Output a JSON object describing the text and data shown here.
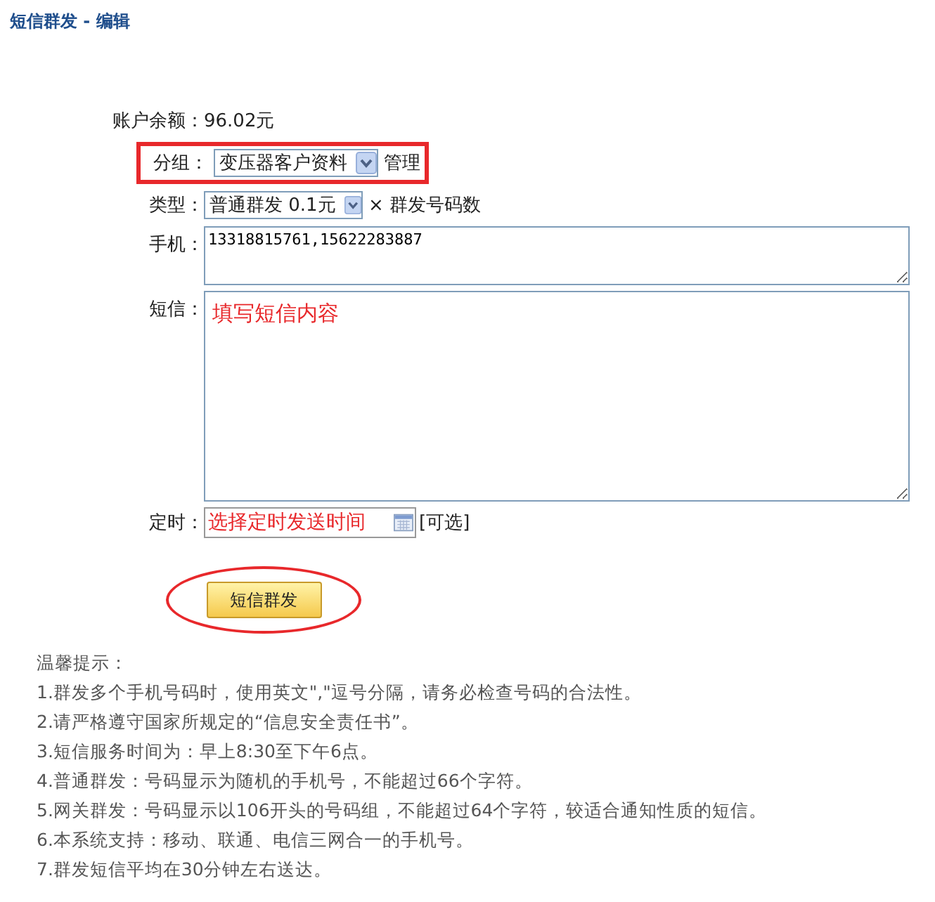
{
  "title": "短信群发 - 编辑",
  "balance": {
    "label": "账户余额：",
    "value": "96.02元"
  },
  "group": {
    "label": "分组：",
    "value": "变压器客户资料",
    "link": "管理",
    "highlighted": true
  },
  "type": {
    "label": "类型：",
    "value": "普通群发 0.1元",
    "suffix": "× 群发号码数"
  },
  "phone": {
    "label": "手机：",
    "value": "13318815761,15622283887"
  },
  "message": {
    "label": "短信：",
    "placeholder": "填写短信内容"
  },
  "schedule": {
    "label": "定时：",
    "placeholder": "选择定时发送时间",
    "suffix": "[可选]"
  },
  "submit": {
    "label": "短信群发",
    "highlighted": true
  },
  "tips": {
    "heading": "温馨提示：",
    "items": [
      "1.群发多个手机号码时，使用英文\",\"逗号分隔，请务必检查号码的合法性。",
      "2.请严格遵守国家所规定的“信息安全责任书”。",
      "3.短信服务时间为：早上8:30至下午6点。",
      "4.普通群发：号码显示为随机的手机号，不能超过66个字符。",
      "5.网关群发：号码显示以106开头的号码组，不能超过64个字符，较适合通知性质的短信。",
      "6.本系统支持：移动、联通、电信三网合一的手机号。",
      "7.群发短信平均在30分钟左右送达。"
    ]
  }
}
